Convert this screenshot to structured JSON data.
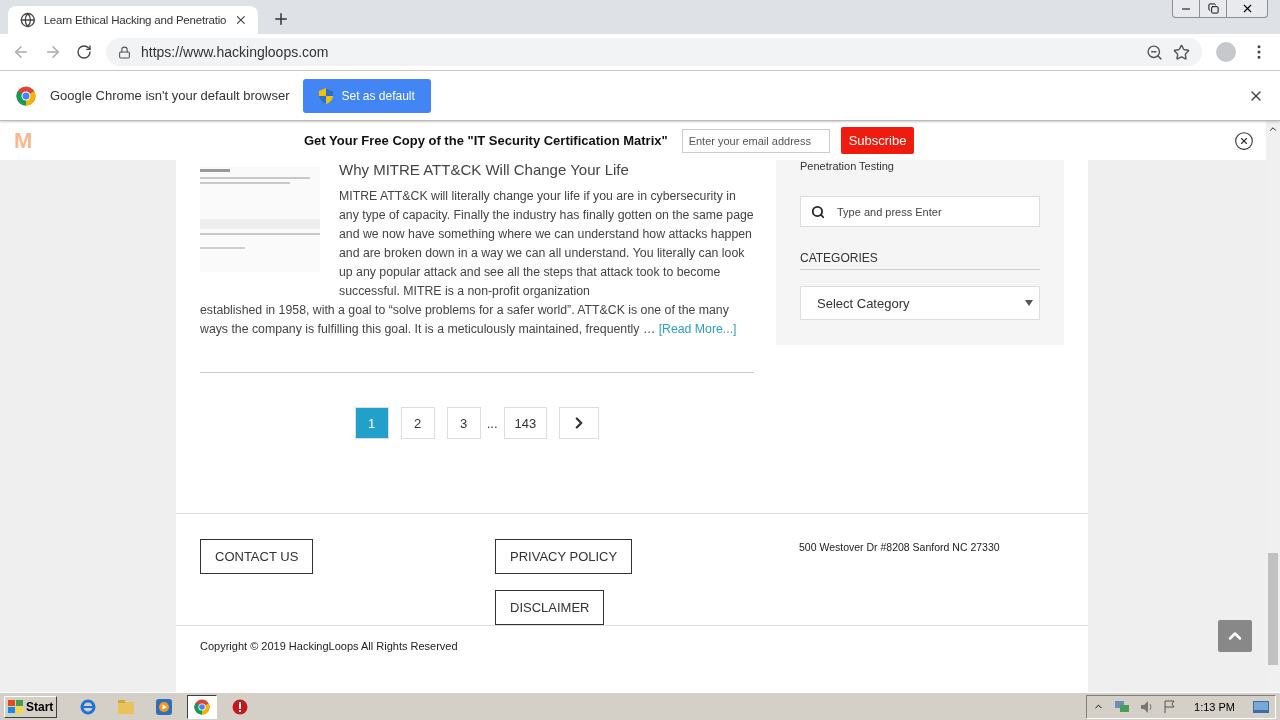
{
  "browser": {
    "tabs": [
      {
        "title": "Learn Ethical Hacking and Penetratio",
        "selected": true
      }
    ],
    "url": "https://www.hackingloops.com"
  },
  "infobar": {
    "message": "Google Chrome isn't your default browser",
    "button": "Set as default"
  },
  "promo": {
    "logo": "M",
    "title": "Get Your Free Copy of the \"IT Security Certification Matrix\"",
    "email": {
      "placeholder": "Enter your email address"
    },
    "button": "Subscribe"
  },
  "article": {
    "title": "Why MITRE ATT&CK Will Change Your Life",
    "excerpt": [
      "MITRE ATT&CK will literally change your life if you are in cybersecurity in any type of capacity.  Finally the industry has finally gotten on the same page and we now have something where we can understand how attacks happen and are broken down in a way we can all understand. You literally can look up any popular attack and see all the steps that attack took to become successful. MITRE is a non-profit organization",
      "established in 1958, with a goal to “solve problems for a safer world”. ATT&CK is one of the many ways the company is fulfilling this goal. It is a meticulously maintained, frequently …"
    ],
    "link": "[Read More...]"
  },
  "pagination": [
    {
      "kind": "page",
      "label": "1",
      "selected": true
    },
    {
      "kind": "page",
      "label": "2",
      "selected": false
    },
    {
      "kind": "page",
      "label": "3",
      "selected": false
    },
    {
      "kind": "ellipsis",
      "label": "..."
    },
    {
      "kind": "page",
      "label": "143",
      "selected": false
    },
    {
      "kind": "next"
    }
  ],
  "sidebar": {
    "top_text": "Penetration Testing",
    "search": {
      "placeholder": "Type and press Enter"
    },
    "heading": "CATEGORIES",
    "select": "Select Category"
  },
  "footer": {
    "columns": [
      {
        "links": [
          "CONTACT US"
        ]
      },
      {
        "links": [
          "PRIVACY POLICY",
          "DISCLAIMER"
        ]
      },
      {
        "address": "500 Westover Dr #8208 Sanford NC 27330"
      }
    ],
    "copyright": "Copyright © 2019 HackingLoops All Rights Reserved"
  },
  "taskbar": {
    "start": "Start",
    "apps": [
      {
        "kind": "ie",
        "selected": false
      },
      {
        "kind": "folder",
        "selected": false
      },
      {
        "kind": "media",
        "selected": false
      },
      {
        "kind": "chrome",
        "selected": true
      },
      {
        "kind": "stop",
        "selected": false
      }
    ],
    "clock": "1:13 PM"
  }
}
